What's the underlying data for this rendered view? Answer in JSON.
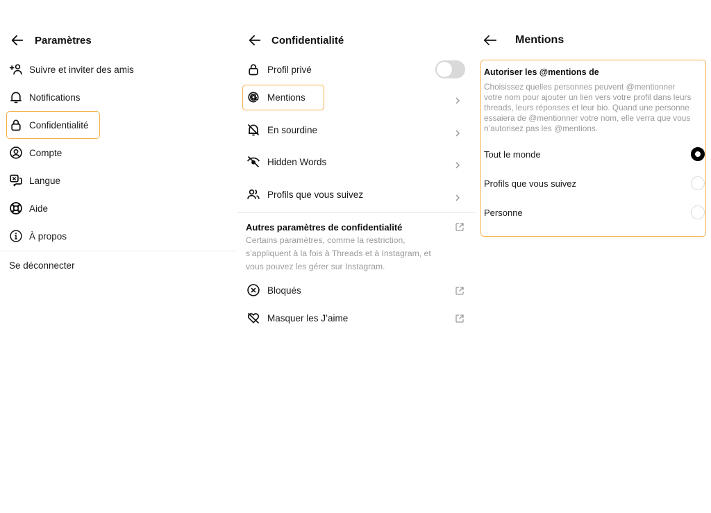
{
  "colors": {
    "highlight": "#f5b04a",
    "text_primary": "#111111",
    "text_secondary": "#9a9a9a",
    "toggle_off": "#d9d9d9",
    "divider": "#e9e9e9"
  },
  "settings": {
    "title": "Paramètres",
    "back_icon": "arrow-left-icon",
    "items": [
      {
        "label": "Suivre et inviter des amis",
        "icon": "add-person-icon"
      },
      {
        "label": "Notifications",
        "icon": "bell-icon"
      },
      {
        "label": "Confidentialité",
        "icon": "lock-icon",
        "highlighted": true
      },
      {
        "label": "Compte",
        "icon": "account-circle-icon"
      },
      {
        "label": "Langue",
        "icon": "translate-icon"
      },
      {
        "label": "Aide",
        "icon": "lifebuoy-icon"
      },
      {
        "label": "À propos",
        "icon": "info-icon"
      }
    ],
    "logout_label": "Se déconnecter"
  },
  "privacy": {
    "title": "Confidentialité",
    "back_icon": "arrow-left-icon",
    "items": [
      {
        "label": "Profil privé",
        "icon": "lock-icon",
        "control": "toggle",
        "toggle_on": false
      },
      {
        "label": "Mentions",
        "icon": "at-sign-icon",
        "control": "chevron",
        "highlighted": true
      },
      {
        "label": "En sourdine",
        "icon": "bell-off-icon",
        "control": "chevron"
      },
      {
        "label": "Hidden Words",
        "icon": "eye-off-icon",
        "control": "chevron"
      },
      {
        "label": "Profils que vous suivez",
        "icon": "people-icon",
        "control": "chevron"
      }
    ],
    "other_section": {
      "title": "Autres paramètres de confidentialité",
      "description_lines": [
        "Certains paramètres, comme la restriction,",
        "s’appliquent à la fois à Threads et à Instagram, et",
        "vous pouvez les gérer sur Instagram."
      ],
      "icon": "external-link-icon"
    },
    "external_items": [
      {
        "label": "Bloqués",
        "icon": "blocked-circle-icon"
      },
      {
        "label": "Masquer les J’aime",
        "icon": "heart-off-icon"
      }
    ]
  },
  "mentions": {
    "title": "Mentions",
    "back_icon": "arrow-left-icon",
    "section_title": "Autoriser les @mentions de",
    "description_lines": [
      "Choisissez quelles personnes peuvent @mentionner",
      "votre nom pour ajouter un lien vers votre profil dans leurs",
      "threads, leurs réponses et leur bio. Quand une personne",
      "essaiera de @mentionner votre nom, elle verra que vous",
      "n’autorisez pas les @mentions."
    ],
    "options": [
      {
        "label": "Tout le monde",
        "selected": true
      },
      {
        "label": "Profils que vous suivez",
        "selected": false
      },
      {
        "label": "Personne",
        "selected": false
      }
    ]
  }
}
